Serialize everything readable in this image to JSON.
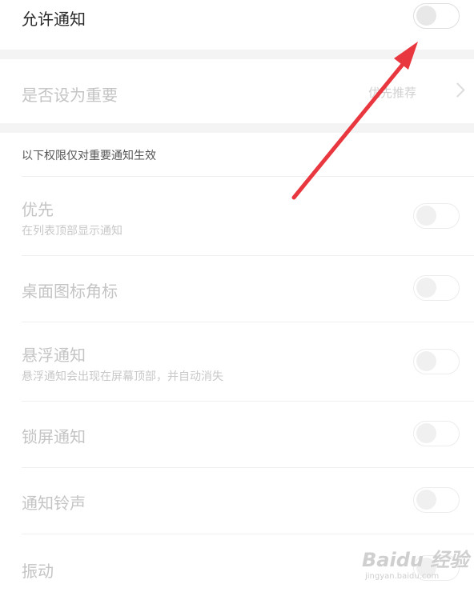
{
  "allow_notification": {
    "label": "允许通知"
  },
  "importance": {
    "label": "是否设为重要",
    "value": "优先推荐"
  },
  "section_header": "以下权限仅对重要通知生效",
  "settings": [
    {
      "label": "优先",
      "sub": "在列表顶部显示通知"
    },
    {
      "label": "桌面图标角标"
    },
    {
      "label": "悬浮通知",
      "sub": "悬浮通知会出现在屏幕顶部，并自动消失"
    },
    {
      "label": "锁屏通知"
    },
    {
      "label": "通知铃声"
    },
    {
      "label": "振动"
    }
  ],
  "watermark": {
    "brand": "Baidu 经验",
    "url": "jingyan.baidu.com"
  },
  "colors": {
    "annotation_arrow": "#e8373f",
    "disabled_text": "#c4c4c4"
  },
  "icons": {
    "row_chevron": "chevron-right-icon",
    "annotation": "red-arrow"
  }
}
